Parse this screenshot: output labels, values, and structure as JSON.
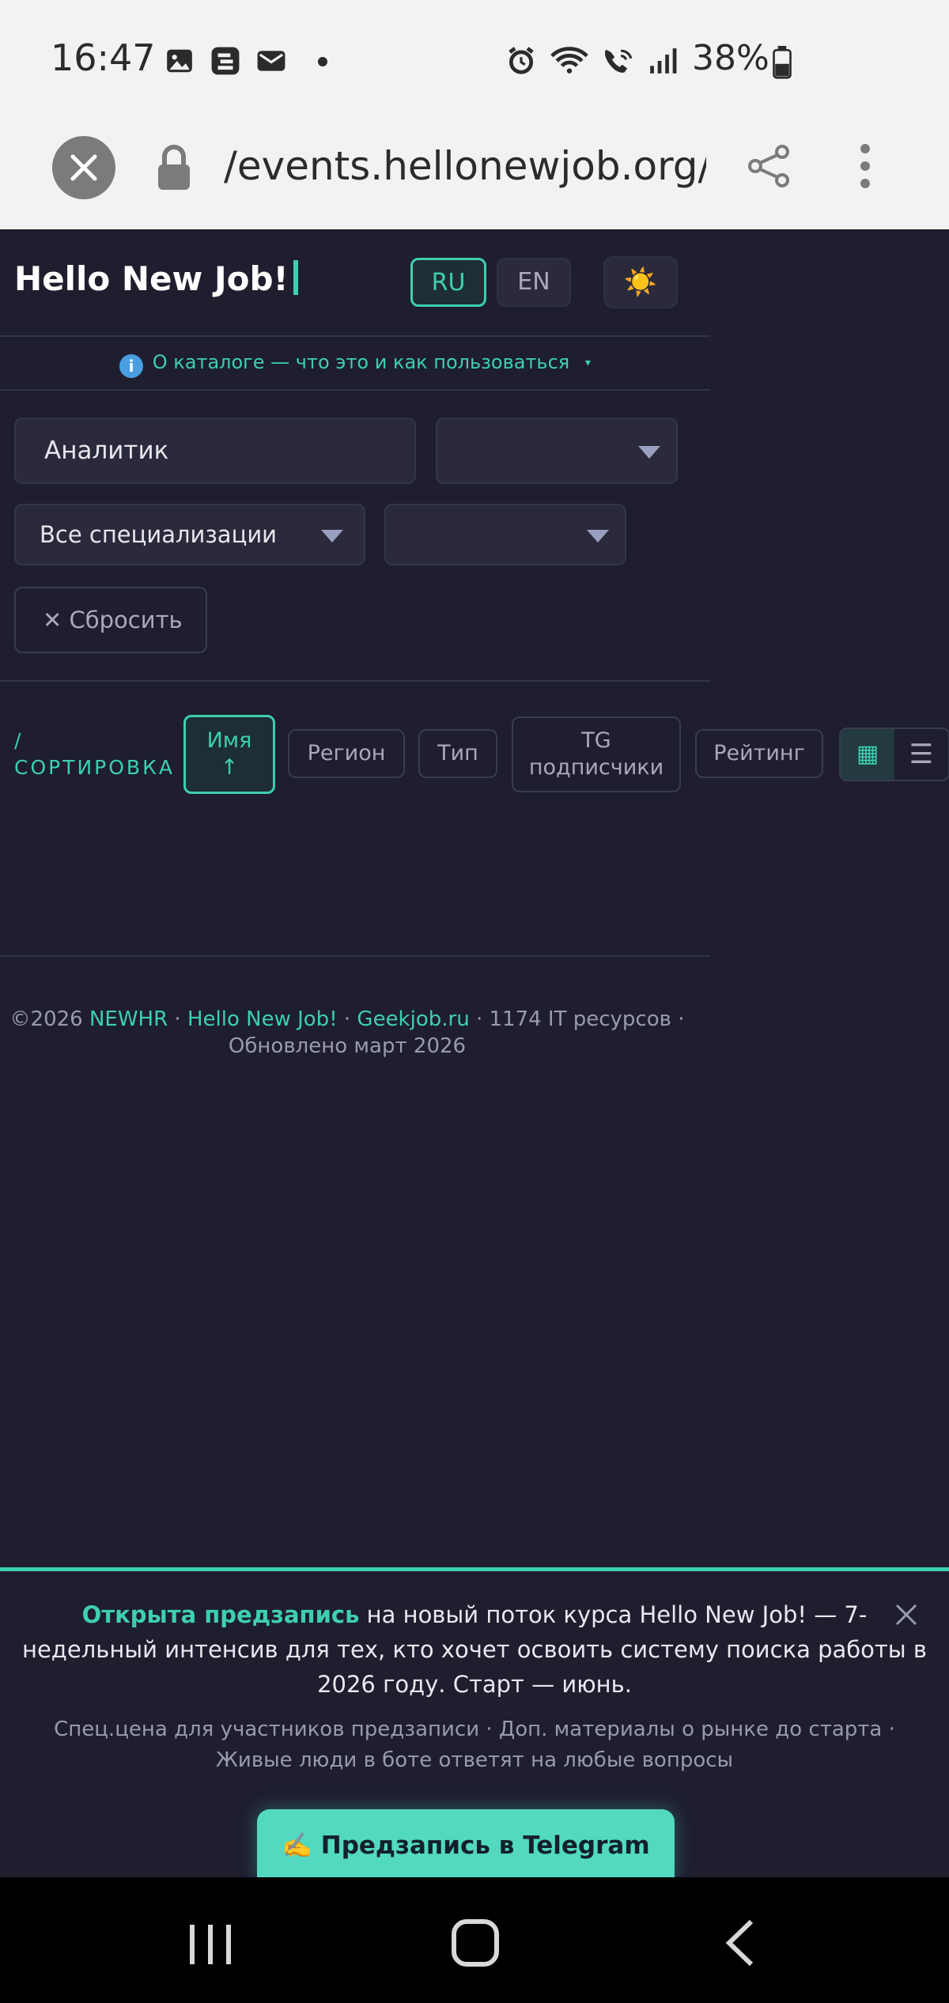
{
  "status_bar": {
    "time": "16:47",
    "battery": "38%",
    "icons": [
      "gallery-icon",
      "app-icon",
      "mail-icon",
      "dot-icon",
      "alarm-icon",
      "wifi-icon",
      "wifi-call-icon",
      "signal-icon",
      "battery-icon"
    ]
  },
  "browser": {
    "url": "/events.hellonewjob.org/c"
  },
  "header": {
    "logo": "Hello New Job!",
    "lang_ru": "RU",
    "lang_en": "EN",
    "theme_icon": "☀️"
  },
  "about": {
    "icon": "i",
    "text": "О каталоге — что это и как пользоваться",
    "caret": "▾"
  },
  "filters": {
    "search_value": "Аналитик",
    "select1_value": "",
    "specialization": "Все специализации",
    "select2_value": "",
    "reset_label": "✕ Сбросить"
  },
  "sort": {
    "label_line1": "/",
    "label_line2": "СОРТИРОВКА",
    "name_label": "Имя",
    "name_arrow": "↑",
    "region": "Регион",
    "type": "Тип",
    "tg_line1": "TG",
    "tg_line2": "подписчики",
    "rating": "Рейтинг",
    "view_grid": "▦",
    "view_list": "☰"
  },
  "footer": {
    "copy": "©2026",
    "newhr": "NEWHR",
    "sep1": " · ",
    "hnj": "Hello New Job!",
    "sep2": " · ",
    "geekjob": "Geekjob.ru",
    "rest": " · 1174 IT ресурсов · Обновлено март 2026"
  },
  "banner": {
    "highlight": "Открыта предзапись",
    "text": " на новый поток курса Hello New Job! — 7-недельный интенсив для тех, кто хочет освоить систему поиска работы в 2026 году. Старт — июнь.",
    "sub": "Спец.цена для участников предзаписи · Доп. материалы о рынке до старта · Живые люди в боте ответят на любые вопросы",
    "button": "✍️ Предзапись в Telegram"
  },
  "colors": {
    "accent": "#3ecfb0",
    "background": "#1e1e2f",
    "button": "#52d9c0"
  }
}
